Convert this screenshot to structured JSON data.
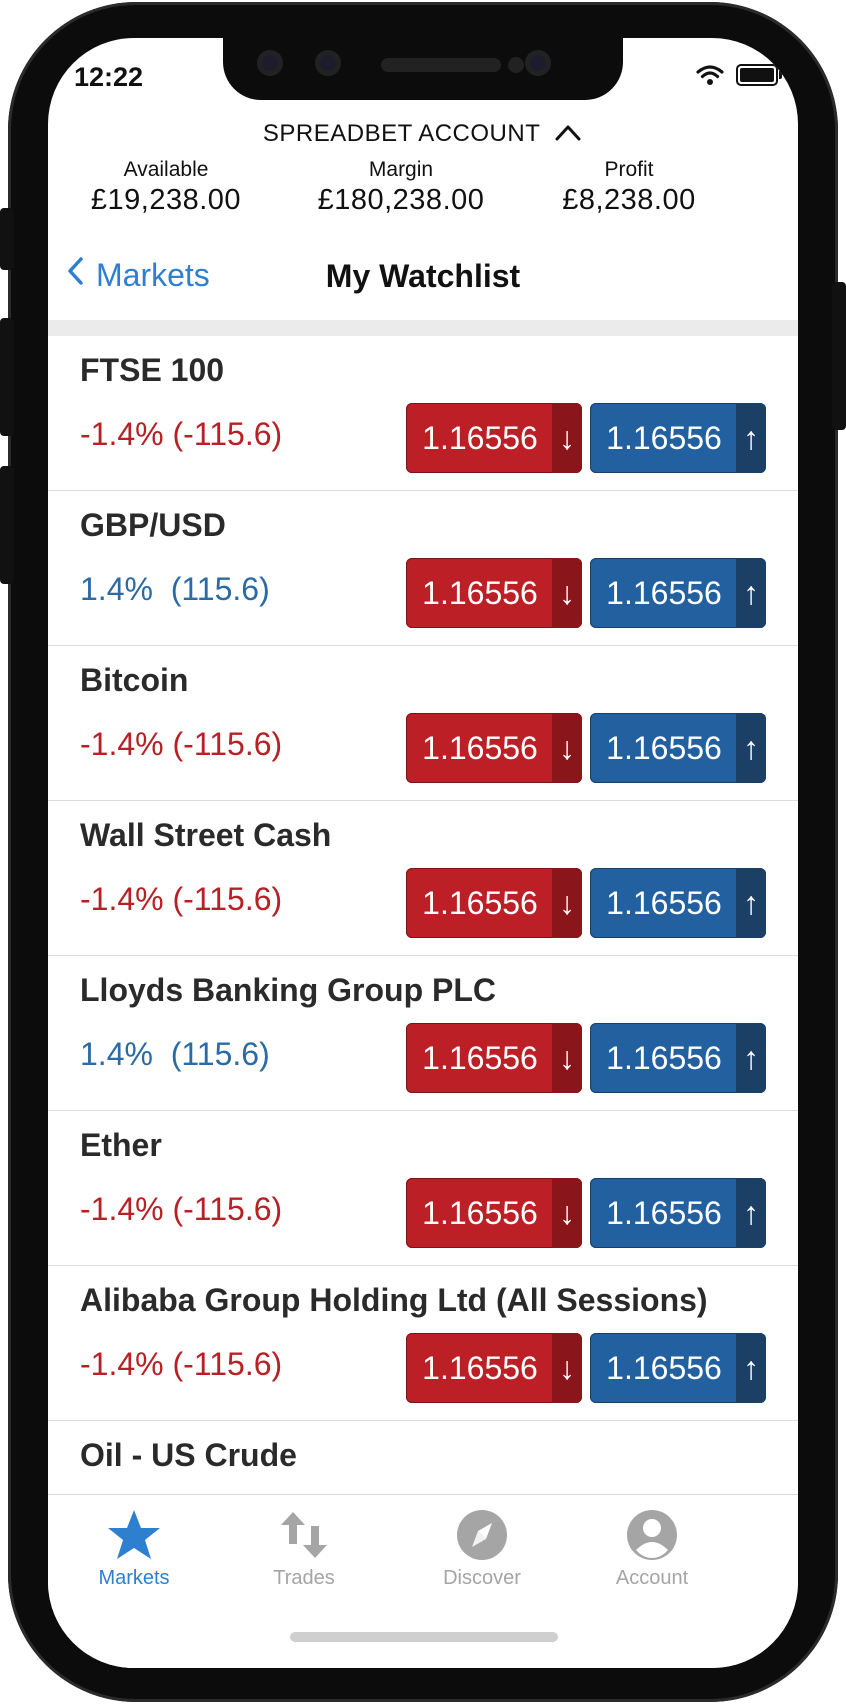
{
  "status_bar": {
    "time": "12:22"
  },
  "account": {
    "type_label": "SPREADBET ACCOUNT",
    "available_label": "Available",
    "available_value": "£19,238.00",
    "margin_label": "Margin",
    "margin_value": "£180,238.00",
    "profit_label": "Profit",
    "profit_value": "£8,238.00"
  },
  "nav": {
    "back_label": "Markets",
    "title": "My Watchlist"
  },
  "markets": [
    {
      "name": "FTSE 100",
      "change_pct": "-1.4%",
      "change_abs": "(-115.6)",
      "direction": "down",
      "sell": "1.16556",
      "buy": "1.16556"
    },
    {
      "name": "GBP/USD",
      "change_pct": "1.4%",
      "change_abs": "(115.6)",
      "direction": "up",
      "sell": "1.16556",
      "buy": "1.16556"
    },
    {
      "name": "Bitcoin",
      "change_pct": "-1.4%",
      "change_abs": "(-115.6)",
      "direction": "down",
      "sell": "1.16556",
      "buy": "1.16556"
    },
    {
      "name": "Wall Street Cash",
      "change_pct": "-1.4%",
      "change_abs": "(-115.6)",
      "direction": "down",
      "sell": "1.16556",
      "buy": "1.16556"
    },
    {
      "name": "Lloyds Banking Group PLC",
      "change_pct": "1.4%",
      "change_abs": "(115.6)",
      "direction": "up",
      "sell": "1.16556",
      "buy": "1.16556"
    },
    {
      "name": "Ether",
      "change_pct": "-1.4%",
      "change_abs": "(-115.6)",
      "direction": "down",
      "sell": "1.16556",
      "buy": "1.16556"
    },
    {
      "name": "Alibaba Group Holding Ltd (All Sessions)",
      "change_pct": "-1.4%",
      "change_abs": "(-115.6)",
      "direction": "down",
      "sell": "1.16556",
      "buy": "1.16556"
    },
    {
      "name": "Oil - US Crude"
    }
  ],
  "tabs": [
    {
      "label": "Markets",
      "icon": "star-icon",
      "active": true
    },
    {
      "label": "Trades",
      "icon": "swap-arrows-icon",
      "active": false
    },
    {
      "label": "Discover",
      "icon": "compass-icon",
      "active": false
    },
    {
      "label": "Account",
      "icon": "user-circle-icon",
      "active": false
    }
  ],
  "colors": {
    "sell": "#bd1f26",
    "buy": "#2360a0",
    "negative": "#b72025",
    "positive": "#2a6aa5",
    "accent": "#2f7fd1"
  }
}
